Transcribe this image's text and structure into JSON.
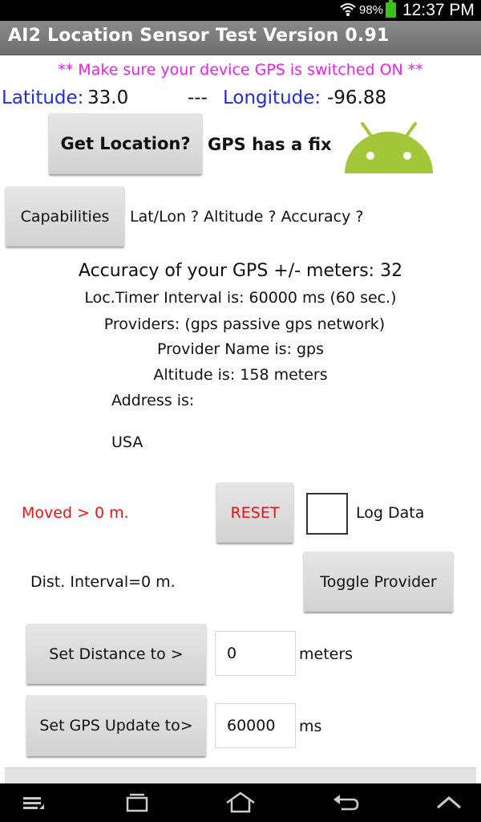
{
  "status_bar": {
    "battery": "98%",
    "time": "12:37 PM",
    "battery_color": "#39c41d"
  },
  "title_bar": {
    "title": "AI2 Location Sensor Test  Version 0.91"
  },
  "gps_notice": "** Make sure your device GPS is switched ON **",
  "coords": {
    "lat_label": "Latitude:",
    "lat_value": "33.0",
    "separator": "---",
    "lon_label": "Longitude:",
    "lon_value": "-96.88"
  },
  "location": {
    "button_label": "Get Location?",
    "status": "GPS has a fix",
    "icon": "android-icon"
  },
  "capabilities": {
    "button_label": "Capabilities",
    "info": "Lat/Lon ? Altitude ? Accuracy ?"
  },
  "info": {
    "accuracy": "Accuracy of your GPS +/- meters:  32",
    "timer": "Loc.Timer Interval is:  60000 ms (60 sec.)",
    "providers": "Providers: (gps passive gps network)",
    "provider_name": "Provider Name is: gps",
    "altitude": "Altitude is:  158 meters",
    "address_label": "Address is:",
    "address_country": "USA"
  },
  "controls": {
    "moved": "Moved > 0 m.",
    "reset_label": "RESET",
    "log_data_label": "Log Data",
    "dist_interval": "Dist. Interval=0 m.",
    "toggle_provider_label": "Toggle Provider",
    "set_distance_label": "Set Distance to >",
    "distance_value": "0",
    "distance_unit": "meters",
    "set_gps_label": "Set GPS Update to>",
    "gps_update_value": "60000",
    "gps_update_unit": "ms"
  },
  "colors": {
    "accent_blue": "#1f2fd6",
    "notice_magenta": "#f01ef0",
    "alert_red": "#ee1111",
    "android_green": "#a4c639"
  },
  "nav_bar": {
    "icons": [
      "menu-icon",
      "recent-apps-icon",
      "home-icon",
      "back-icon",
      "collapse-icon"
    ]
  }
}
